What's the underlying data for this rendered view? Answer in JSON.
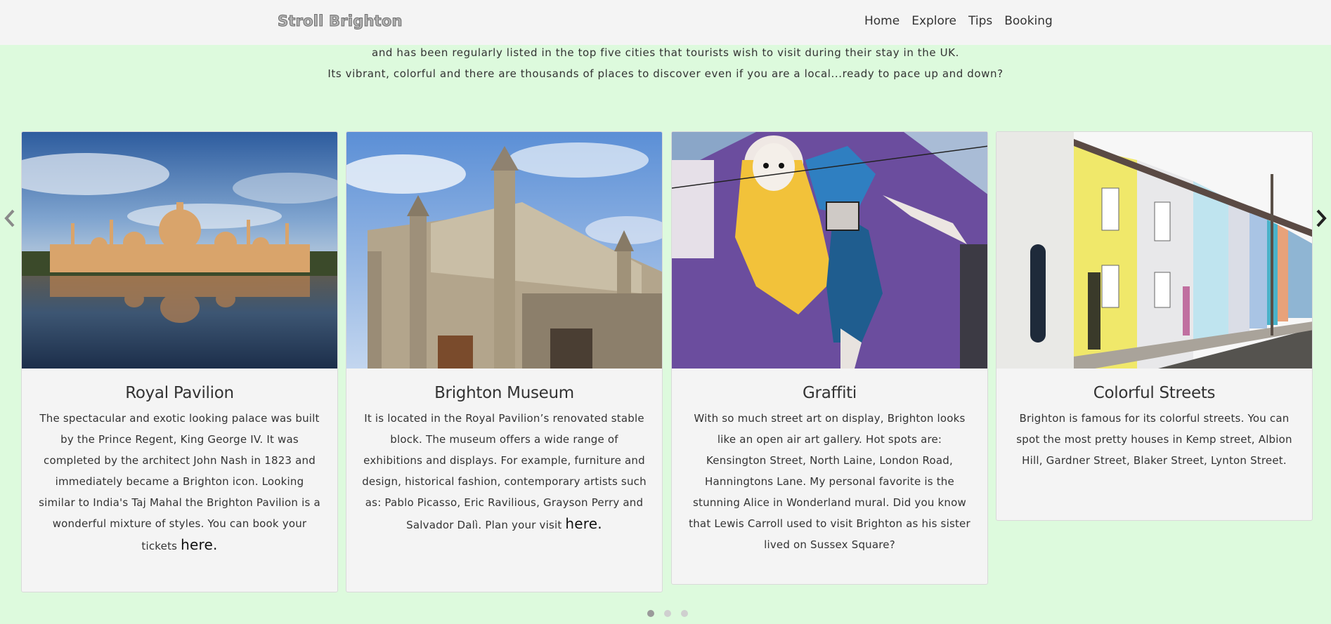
{
  "nav": {
    "brand": "Stroll Brighton",
    "links": [
      "Home",
      "Explore",
      "Tips",
      "Booking"
    ]
  },
  "intro": {
    "line1": "and has been regularly listed in the top five cities that tourists wish to visit during their stay in the UK.",
    "line2": "Its vibrant, colorful and there are thousands of places to discover even if you are a local...ready to pace up and down?"
  },
  "carousel": {
    "prev_icon": "chevron-left-icon",
    "next_icon": "chevron-right-icon",
    "dots": 3,
    "active_dot": 0,
    "cards": [
      {
        "image": "royal-pavilion-photo",
        "title": "Royal Pavilion",
        "text": "The spectacular and exotic looking palace was built by the Prince Regent, King George IV. It was completed by the architect John Nash in 1823 and immediately became a Brighton icon. Looking similar to India's Taj Mahal the Brighton Pavilion is a wonderful mixture of styles. You can book your tickets ",
        "link": "here."
      },
      {
        "image": "brighton-museum-photo",
        "title": "Brighton Museum",
        "text": "It is located in the Royal Pavilion’s renovated stable block. The museum offers a wide range of exhibitions and displays. For example, furniture and design, historical fashion, contemporary artists such as: Pablo Picasso, Eric Ravilious, Grayson Perry and Salvador Dalì. Plan your visit ",
        "link": "here."
      },
      {
        "image": "graffiti-mural-photo",
        "title": "Graffiti",
        "text": "With so much street art on display, Brighton looks like an open air art gallery. Hot spots are: Kensington Street, North Laine, London Road, Hanningtons Lane. My personal favorite is the stunning Alice in Wonderland mural. Did you know that Lewis Carroll used to visit Brighton as his sister lived on Sussex Square?",
        "link": ""
      },
      {
        "image": "colorful-streets-photo",
        "title": "Colorful Streets",
        "text": "Brighton is famous for its colorful streets. You can spot the most pretty houses in Kemp street, Albion Hill, Gardner Street, Blaker Street, Lynton Street.",
        "link": ""
      }
    ]
  }
}
